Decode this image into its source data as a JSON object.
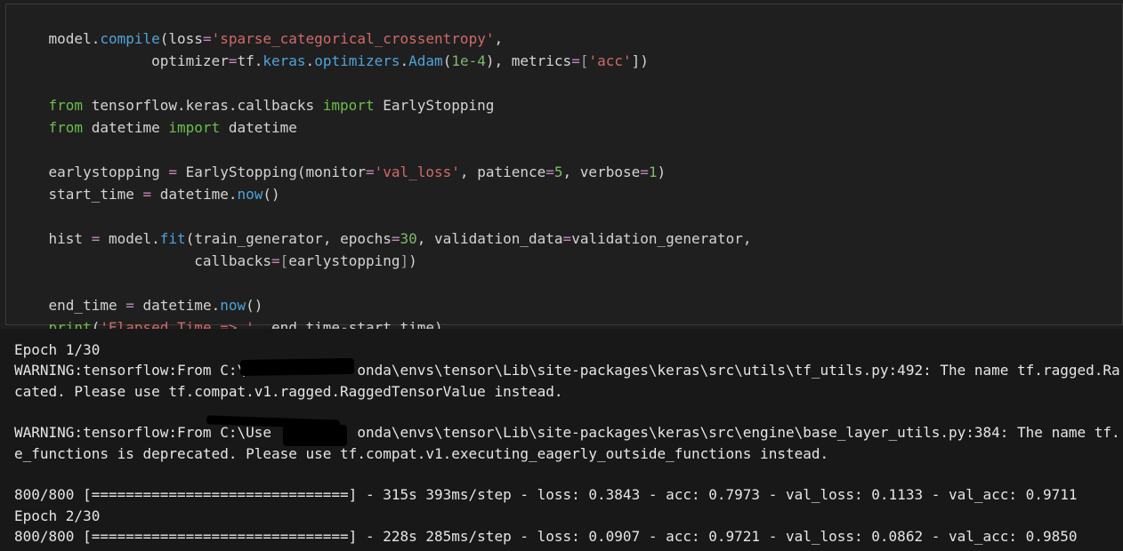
{
  "code": {
    "l1_a": "model.",
    "l1_b": "compile",
    "l1_c": "(loss",
    "l1_d": "=",
    "l1_e": "'sparse_categorical_crossentropy'",
    "l1_f": ",",
    "l2_a": "            optimizer",
    "l2_b": "=",
    "l2_c": "tf.",
    "l2_d": "keras",
    "l2_e": ".",
    "l2_f": "optimizers",
    "l2_g": ".",
    "l2_h": "Adam",
    "l2_i": "(",
    "l2_j": "1e-4",
    "l2_k": "), metrics",
    "l2_l": "=",
    "l2_m": "[",
    "l2_n": "'acc'",
    "l2_o": "])",
    "l4_a": "from",
    "l4_b": " tensorflow.keras.callbacks ",
    "l4_c": "import",
    "l4_d": " EarlyStopping",
    "l5_a": "from",
    "l5_b": " datetime ",
    "l5_c": "import",
    "l5_d": " datetime",
    "l7_a": "earlystopping ",
    "l7_b": "=",
    "l7_c": " EarlyStopping(monitor",
    "l7_d": "=",
    "l7_e": "'val_loss'",
    "l7_f": ", patience",
    "l7_g": "=",
    "l7_h": "5",
    "l7_i": ", verbose",
    "l7_j": "=",
    "l7_k": "1",
    "l7_l": ")",
    "l8_a": "start_time ",
    "l8_b": "=",
    "l8_c": " datetime.",
    "l8_d": "now",
    "l8_e": "()",
    "l10_a": "hist ",
    "l10_b": "=",
    "l10_c": " model.",
    "l10_d": "fit",
    "l10_e": "(train_generator, epochs",
    "l10_f": "=",
    "l10_g": "30",
    "l10_h": ", validation_data",
    "l10_i": "=",
    "l10_j": "validation_generator,",
    "l11_a": "                 callbacks",
    "l11_b": "=",
    "l11_c": "[",
    "l11_d": "earlystopping",
    "l11_e": "]",
    "l11_f": ")",
    "l13_a": "end_time ",
    "l13_b": "=",
    "l13_c": " datetime.",
    "l13_d": "now",
    "l13_e": "()",
    "l14_a": "print",
    "l14_b": "(",
    "l14_c": "'Elapsed Time => '",
    "l14_d": ", end_time",
    "l14_e": "-",
    "l14_f": "start_time)"
  },
  "output": {
    "o1": "Epoch 1/30",
    "o2": "WARNING:tensorflow:From C:\\Use          onda\\envs\\tensor\\Lib\\site-packages\\keras\\src\\utils\\tf_utils.py:492: The name tf.ragged.Ra",
    "o3": "cated. Please use tf.compat.v1.ragged.RaggedTensorValue instead.",
    "o4": "WARNING:tensorflow:From C:\\Use          onda\\envs\\tensor\\Lib\\site-packages\\keras\\src\\engine\\base_layer_utils.py:384: The name tf.",
    "o5": "e_functions is deprecated. Please use tf.compat.v1.executing_eagerly_outside_functions instead.",
    "o6": "800/800 [==============================] - 315s 393ms/step - loss: 0.3843 - acc: 0.7973 - val_loss: 0.1133 - val_acc: 0.9711",
    "o7": "Epoch 2/30",
    "o8": "800/800 [==============================] - 228s 285ms/step - loss: 0.0907 - acc: 0.9721 - val_loss: 0.0862 - val_acc: 0.9850"
  }
}
